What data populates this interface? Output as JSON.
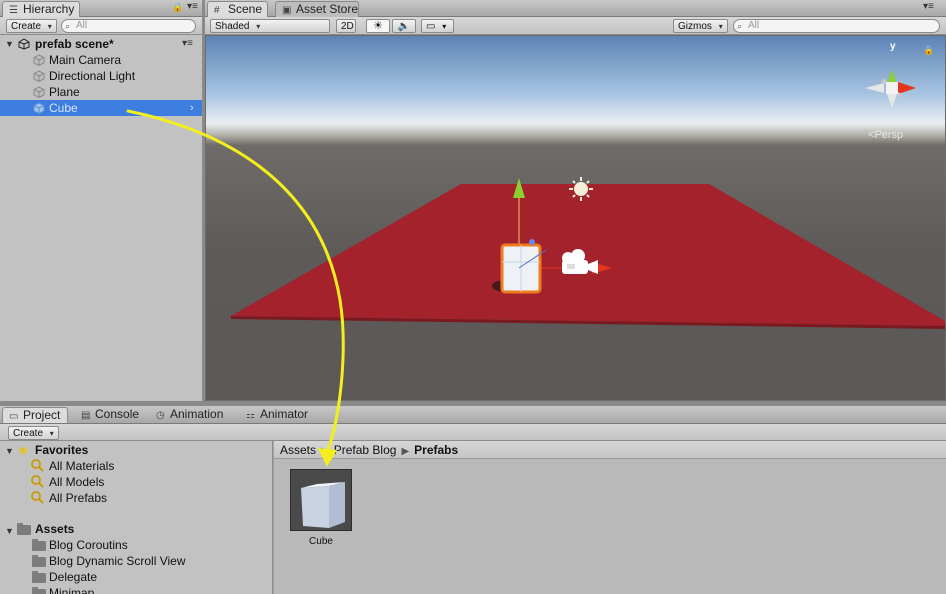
{
  "hierarchy": {
    "tab_label": "Hierarchy",
    "create_label": "Create",
    "search_placeholder": "All",
    "scene_name": "prefab scene*",
    "items": [
      {
        "label": "Main Camera"
      },
      {
        "label": "Directional Light"
      },
      {
        "label": "Plane"
      },
      {
        "label": "Cube"
      }
    ]
  },
  "scene": {
    "tabs": [
      {
        "label": "Scene"
      },
      {
        "label": "Asset Store"
      }
    ],
    "shading_mode": "Shaded",
    "mode_2d": "2D",
    "gizmos_label": "Gizmos",
    "search_placeholder": "All",
    "gizmo_axis_label": "y",
    "persp_label": "Persp"
  },
  "bottom_tabs": [
    {
      "label": "Project"
    },
    {
      "label": "Console"
    },
    {
      "label": "Animation"
    },
    {
      "label": "Animator"
    }
  ],
  "project": {
    "create_label": "Create",
    "favorites_label": "Favorites",
    "favorites": [
      {
        "label": "All Materials"
      },
      {
        "label": "All Models"
      },
      {
        "label": "All Prefabs"
      }
    ],
    "assets_label": "Assets",
    "folders": [
      {
        "label": "Blog Coroutins"
      },
      {
        "label": "Blog Dynamic Scroll View"
      },
      {
        "label": "Delegate"
      },
      {
        "label": "Minimap"
      }
    ],
    "breadcrumb": [
      "Assets",
      "Prefab Blog",
      "Prefabs"
    ],
    "asset_item": {
      "label": "Cube"
    }
  },
  "colors": {
    "selection": "#3e7de0",
    "plane_red": "#a3222b",
    "annotation_arrow": "#f4ef1c",
    "gizmo_y": "#8ad12f",
    "gizmo_x": "#e3341e"
  }
}
